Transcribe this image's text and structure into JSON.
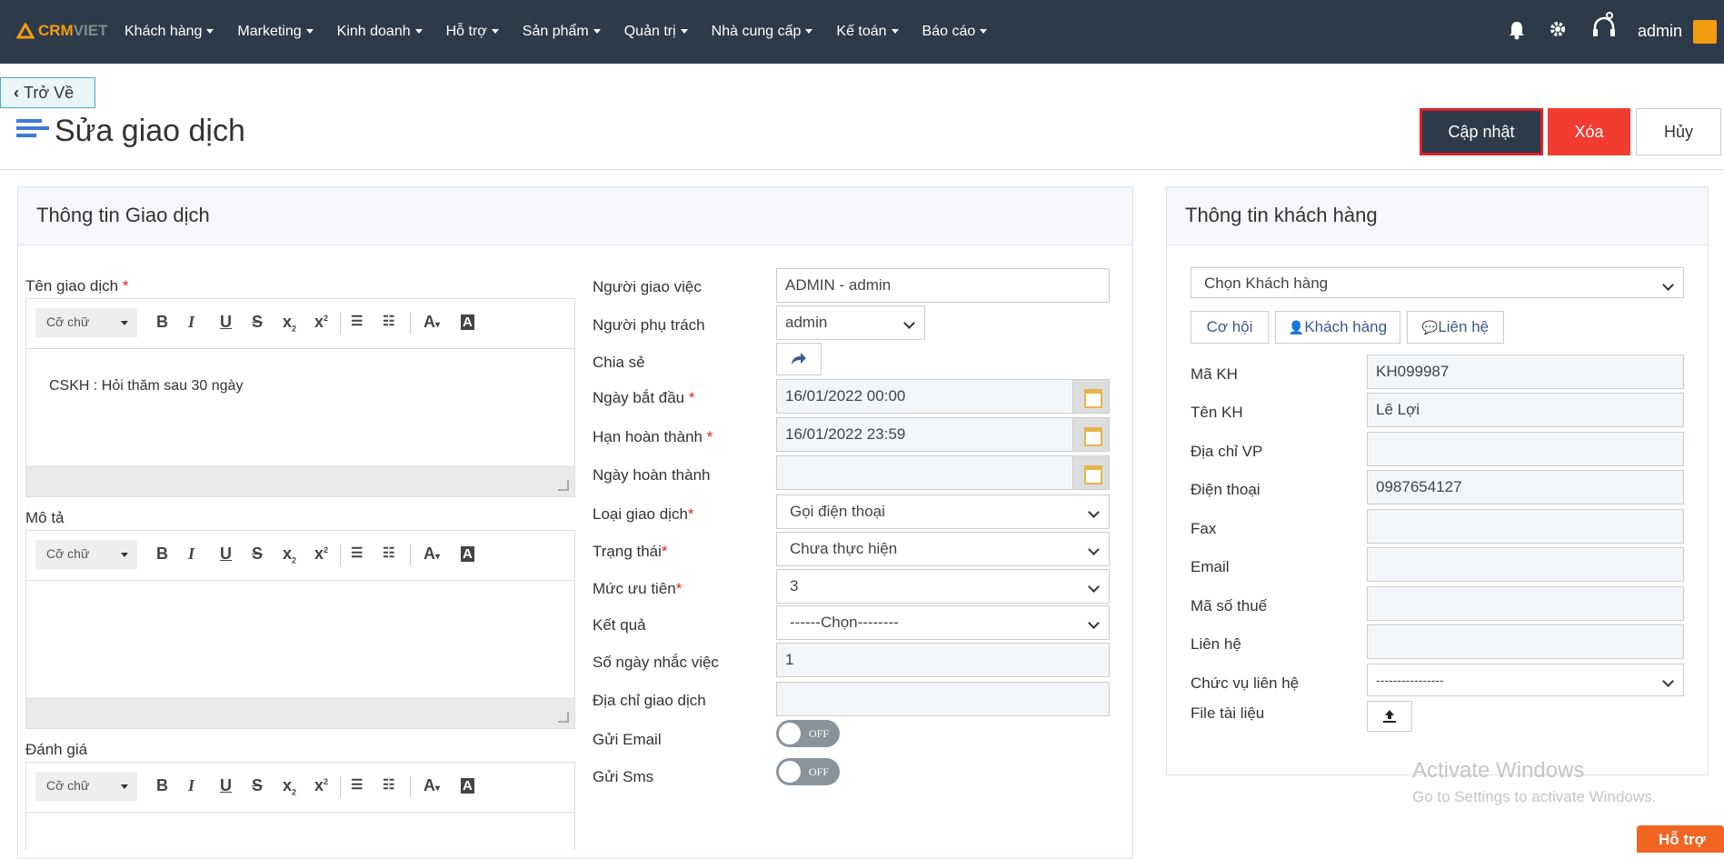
{
  "nav": {
    "logo_a": "CRM",
    "logo_b": "VIET",
    "items": [
      "Khách hàng",
      "Marketing",
      "Kinh doanh",
      "Hỗ trợ",
      "Sản phẩm",
      "Quản trị",
      "Nhà cung cấp",
      "Kế toán",
      "Báo cáo"
    ],
    "user": "admin"
  },
  "back_label": "Trở Về",
  "page_title": "Sửa giao dịch",
  "actions": {
    "update": "Cập nhật",
    "delete": "Xóa",
    "cancel": "Hủy"
  },
  "left_panel": {
    "title": "Thông tin Giao dịch",
    "editors": [
      {
        "label": "Tên giao dịch",
        "required": "*",
        "content": "CSKH : Hỏi thăm sau 30 ngày"
      },
      {
        "label": "Mô tả",
        "required": "",
        "content": ""
      },
      {
        "label": "Đánh giá",
        "required": "",
        "content": ""
      }
    ],
    "font_select": "Cỡ chữ",
    "fields": {
      "assigner": {
        "label": "Người giao việc",
        "value": "ADMIN - admin"
      },
      "owner": {
        "label": "Người phụ trách",
        "value": "admin"
      },
      "share": {
        "label": "Chia sẻ"
      },
      "start": {
        "label": "Ngày bắt đầu",
        "value": "16/01/2022 00:00"
      },
      "deadline": {
        "label": "Hạn hoàn thành",
        "value": "16/01/2022 23:59"
      },
      "done": {
        "label": "Ngày hoàn thành",
        "value": ""
      },
      "type": {
        "label": "Loại giao dịch",
        "value": "Gọi điện thoại"
      },
      "status": {
        "label": "Trạng thái",
        "value": "Chưa thực hiện"
      },
      "priority": {
        "label": "Mức ưu tiên",
        "value": "3"
      },
      "result": {
        "label": "Kết quả",
        "value": "------Chọn--------"
      },
      "remind": {
        "label": "Số ngày nhắc việc",
        "value": "1"
      },
      "address": {
        "label": "Địa chỉ giao dịch",
        "value": ""
      },
      "email": {
        "label": "Gửi Email",
        "state": "OFF"
      },
      "sms": {
        "label": "Gửi Sms",
        "state": "OFF"
      }
    },
    "star": "*"
  },
  "right_panel": {
    "title": "Thông tin khách hàng",
    "customer_select": "Chọn Khách hàng",
    "tabs": [
      "Cơ hội",
      "Khách hàng",
      "Liên hệ"
    ],
    "fields": [
      {
        "label": "Mã KH",
        "value": "KH099987"
      },
      {
        "label": "Tên KH",
        "value": "Lê Lợi"
      },
      {
        "label": "Địa chỉ VP",
        "value": ""
      },
      {
        "label": "Điện thoại",
        "value": "0987654127"
      },
      {
        "label": "Fax",
        "value": ""
      },
      {
        "label": "Email",
        "value": ""
      },
      {
        "label": "Mã số thuế",
        "value": ""
      },
      {
        "label": "Liên hệ",
        "value": ""
      }
    ],
    "position": {
      "label": "Chức vụ liên hệ",
      "value": "----------------"
    },
    "file": {
      "label": "File tài liệu"
    }
  },
  "watermark": {
    "line1": "Activate Windows",
    "line2": "Go to Settings to activate Windows."
  },
  "support": "Hỗ trợ"
}
